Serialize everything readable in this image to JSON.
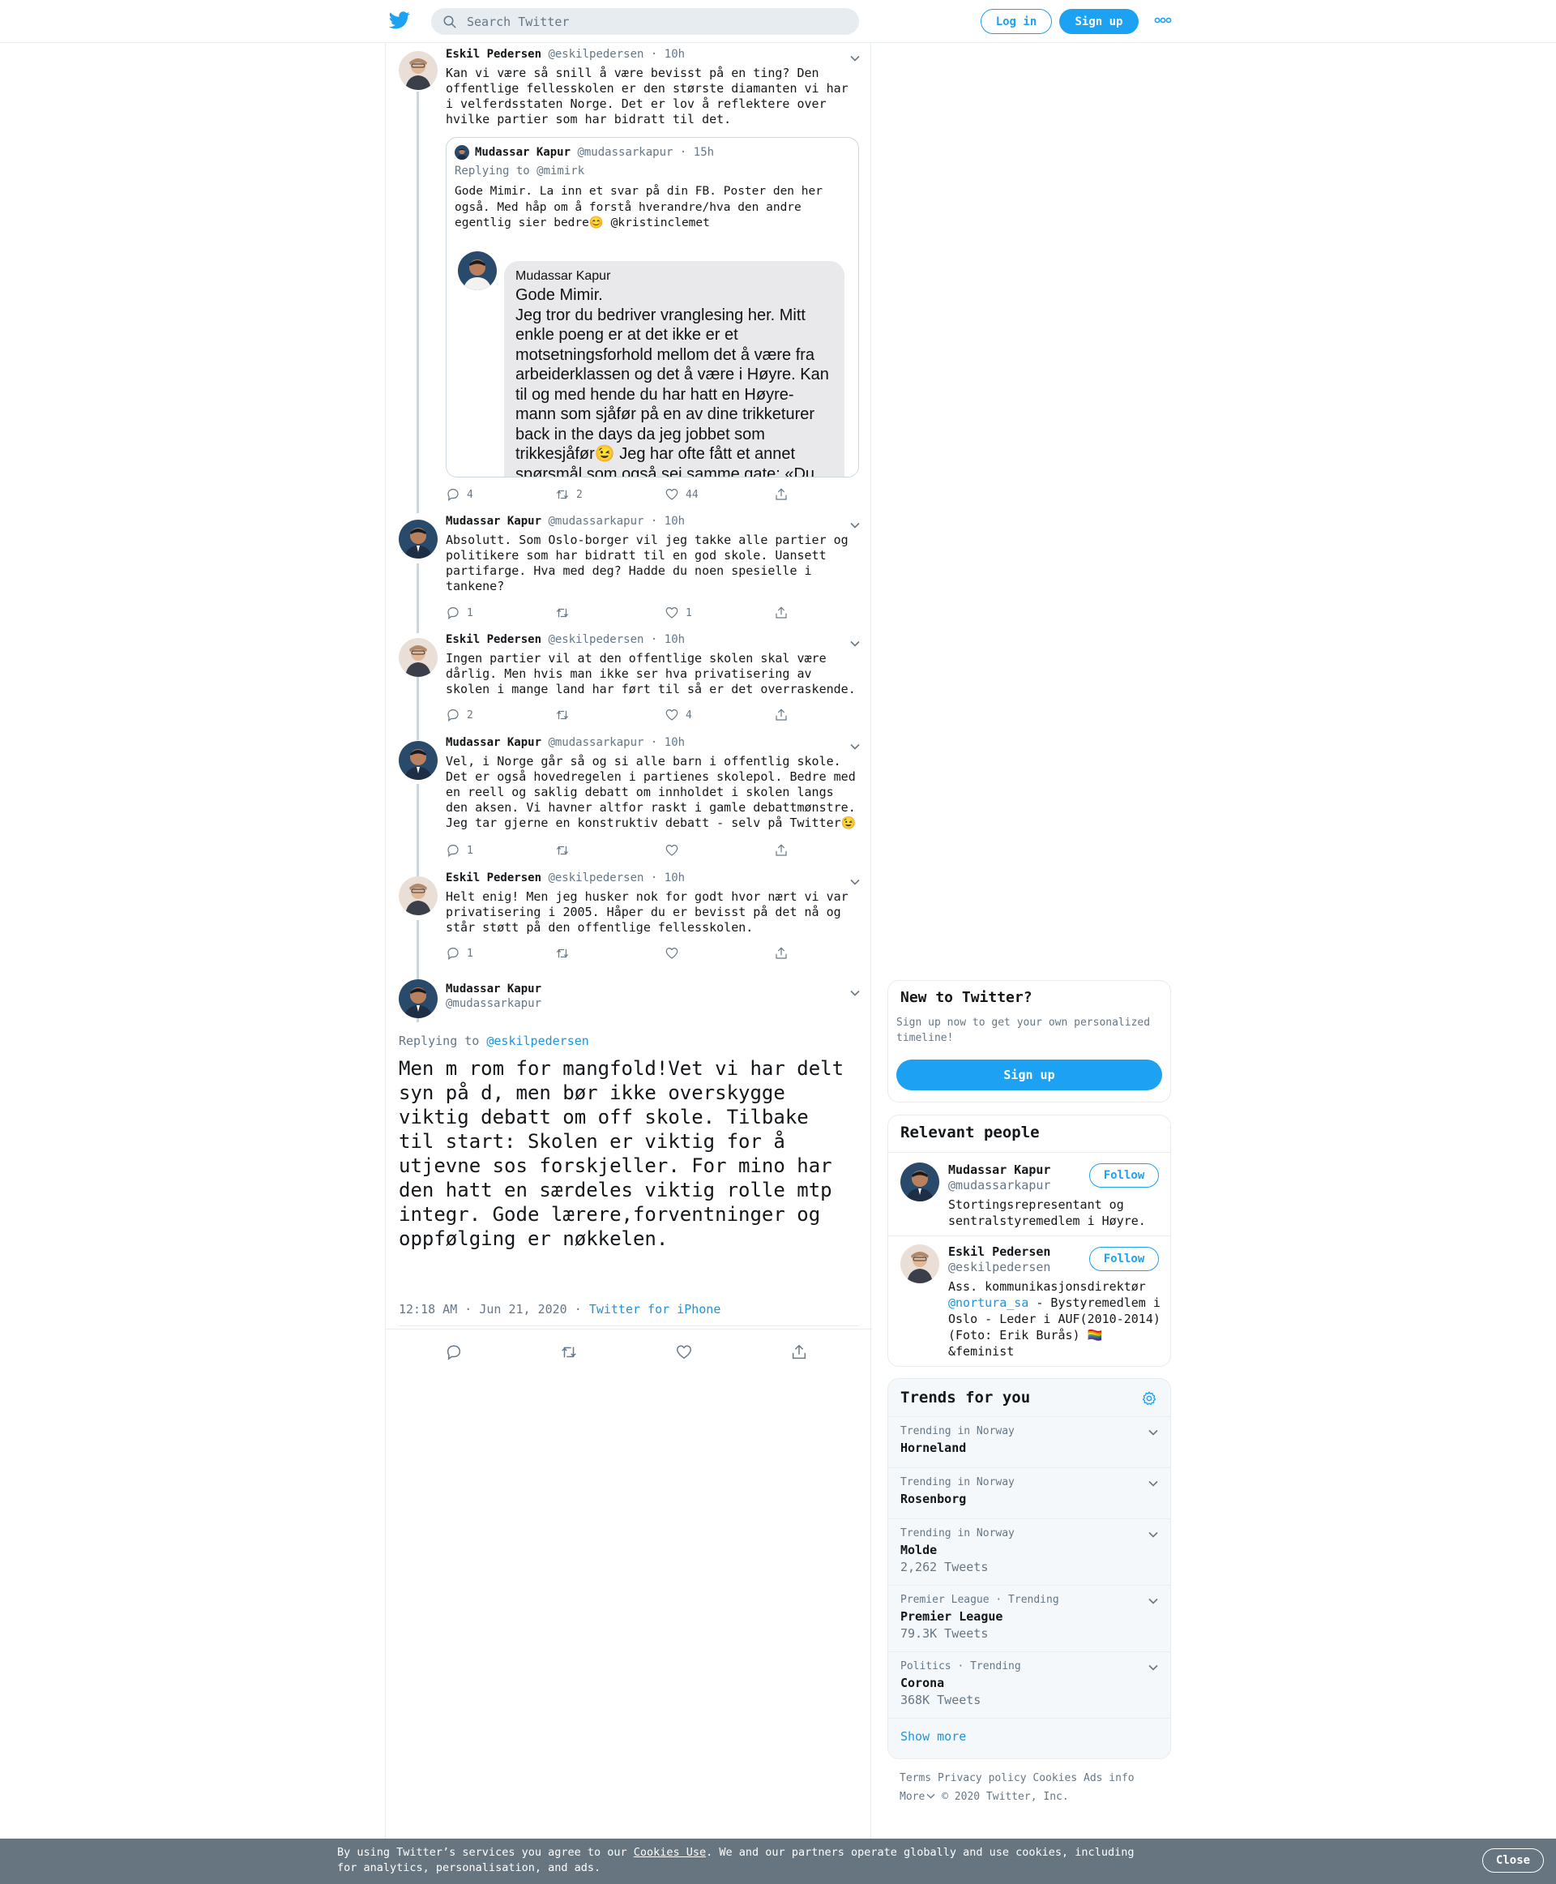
{
  "header": {
    "search_placeholder": "Search Twitter",
    "login_label": "Log in",
    "signup_label": "Sign up",
    "brand_color": "#1da1f2"
  },
  "tweets": [
    {
      "name": "Eskil Pedersen",
      "handle": "@eskilpedersen",
      "time": "· 10h",
      "text": "Kan vi være så snill å være bevisst på en ting? Den offentlige fellesskolen er den største diamanten vi har i velferdsstaten Norge. Det er lov å reflektere over hvilke partier som har bidratt til det.",
      "replies": "4",
      "retweets": "2",
      "likes": "44",
      "quote": {
        "name": "Mudassar Kapur",
        "handle": "@mudassarkapur",
        "time": "· 15h",
        "replying": "Replying to @mimirk",
        "text": "Gode Mimir. La inn et svar på din FB. Poster den her også. Med håp om å forstå hverandre/hva den andre egentlig sier bedre😊 @kristinclemet",
        "bubble_name": "Mudassar Kapur",
        "bubble_text": "Gode Mimir.\nJeg tror du bedriver vranglesing her. Mitt enkle poeng er at det ikke er et motsetningsforhold mellom det å være fra arbeiderklassen og det å være i Høyre. Kan til og med hende du har hatt en Høyre-mann som sjåfør på en av dine trikketurer back in the days da jeg jobbet som trikkesjåfør😉 Jeg har ofte fått et annet spørsmål som også sei samme gate: «Du"
      }
    },
    {
      "name": "Mudassar Kapur",
      "handle": "@mudassarkapur",
      "time": "· 10h",
      "text": "Absolutt. Som Oslo-borger vil jeg takke alle partier og politikere som har bidratt til en god skole. Uansett partifarge. Hva med deg? Hadde du noen spesielle i tankene?",
      "replies": "1",
      "retweets": "",
      "likes": "1"
    },
    {
      "name": "Eskil Pedersen",
      "handle": "@eskilpedersen",
      "time": "· 10h",
      "text": "Ingen partier vil at den offentlige skolen skal være dårlig. Men hvis man ikke ser hva privatisering av skolen i mange land har ført til så er det overraskende.",
      "replies": "2",
      "retweets": "",
      "likes": "4"
    },
    {
      "name": "Mudassar Kapur",
      "handle": "@mudassarkapur",
      "time": "· 10h",
      "text": "Vel, i Norge går så og si alle barn i offentlig skole. Det er også hovedregelen i partienes skolepol. Bedre med en reell og saklig debatt om innholdet i skolen langs den aksen. Vi havner altfor raskt i gamle debattmønstre. Jeg tar gjerne en konstruktiv debatt - selv på Twitter😉",
      "replies": "1",
      "retweets": "",
      "likes": ""
    },
    {
      "name": "Eskil Pedersen",
      "handle": "@eskilpedersen",
      "time": "· 10h",
      "text": "Helt enig! Men jeg husker nok for godt hvor nært vi var privatisering i 2005. Håper du er bevisst på det nå og står støtt på den offentlige fellesskolen.",
      "replies": "1",
      "retweets": "",
      "likes": ""
    }
  ],
  "focused": {
    "name": "Mudassar Kapur",
    "handle": "@mudassarkapur",
    "replying_prefix": "Replying to",
    "replying_to": "@eskilpedersen",
    "text": "Men m rom for mangfold!Vet vi har delt syn på d, men bør ikke overskygge viktig debatt om off skole. Tilbake til start: Skolen er viktig for å utjevne sos forskjeller. For mino har den hatt en særdeles viktig rolle mtp integr. Gode lærere,forventninger og oppfølging er nøkkelen.",
    "timestamp": "12:18 AM · Jun 21, 2020 ·",
    "source": "Twitter for iPhone"
  },
  "sidebar": {
    "new_title": "New to Twitter?",
    "new_desc": "Sign up now to get your own personalized timeline!",
    "new_signup": "Sign up",
    "relevant_title": "Relevant people",
    "people": [
      {
        "name": "Mudassar Kapur",
        "handle": "@mudassarkapur",
        "follow": "Follow",
        "bio": "Stortingsrepresentant og sentralstyremedlem i Høyre."
      },
      {
        "name": "Eskil Pedersen",
        "handle": "@eskilpedersen",
        "follow": "Follow",
        "bio_prefix": "Ass. kommunikasjonsdirektør",
        "bio_link": "@nortura_sa",
        "bio_rest": " - Bystyremedlem i Oslo - Leder i AUF(2010-2014) (Foto: Erik Burås) 🏳️‍🌈 &feminist"
      }
    ],
    "trends_title": "Trends for you",
    "trends": [
      {
        "meta": "Trending in Norway",
        "name": "Horneland",
        "count": ""
      },
      {
        "meta": "Trending in Norway",
        "name": "Rosenborg",
        "count": ""
      },
      {
        "meta": "Trending in Norway",
        "name": "Molde",
        "count": "2,262 Tweets"
      },
      {
        "meta": "Premier League · Trending",
        "name": "Premier League",
        "count": "79.3K Tweets"
      },
      {
        "meta": "Politics · Trending",
        "name": "Corona",
        "count": "368K Tweets"
      }
    ],
    "show_more": "Show more",
    "footer": {
      "terms": "Terms",
      "privacy": "Privacy policy",
      "cookies": "Cookies",
      "ads": "Ads info",
      "more": "More",
      "copyright": "© 2020 Twitter, Inc."
    }
  },
  "cookie_bar": {
    "text_before": "By using Twitter’s services you agree to our ",
    "link": "Cookies Use",
    "text_after": ". We and our partners operate globally and use cookies, including for analytics, personalisation, and ads.",
    "close": "Close"
  }
}
